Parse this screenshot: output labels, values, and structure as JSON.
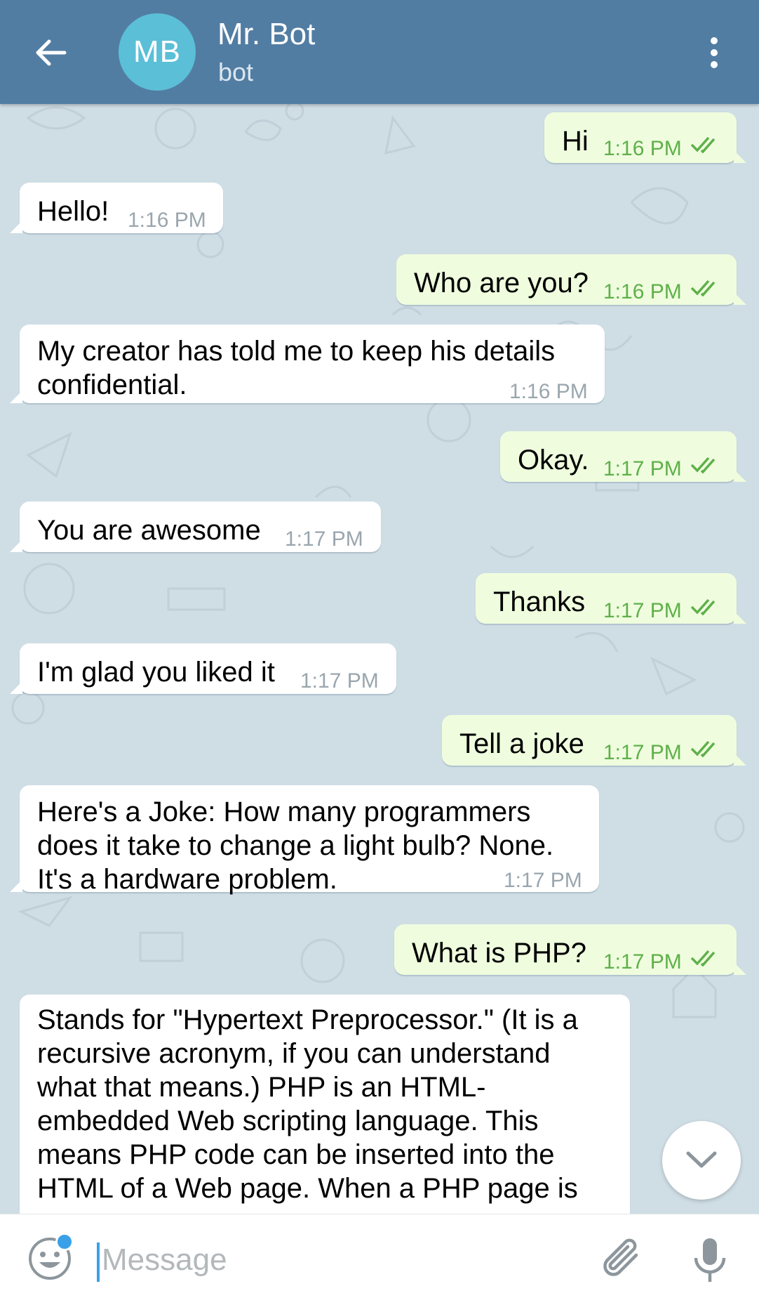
{
  "header": {
    "avatar_initials": "MB",
    "title": "Mr. Bot",
    "subtitle": "bot"
  },
  "messages": [
    {
      "dir": "out",
      "text": "Hi",
      "time": "1:16 PM",
      "status": "read"
    },
    {
      "dir": "in",
      "text": "Hello!",
      "time": "1:16 PM"
    },
    {
      "dir": "out",
      "text": "Who are you?",
      "time": "1:16 PM",
      "status": "read"
    },
    {
      "dir": "in",
      "text": "My creator has told me to keep his details confidential.",
      "time": "1:16 PM"
    },
    {
      "dir": "out",
      "text": "Okay.",
      "time": "1:17 PM",
      "status": "read"
    },
    {
      "dir": "in",
      "text": "You are awesome",
      "time": "1:17 PM"
    },
    {
      "dir": "out",
      "text": "Thanks",
      "time": "1:17 PM",
      "status": "read"
    },
    {
      "dir": "in",
      "text": "I'm glad you liked it",
      "time": "1:17 PM"
    },
    {
      "dir": "out",
      "text": "Tell a joke",
      "time": "1:17 PM",
      "status": "read"
    },
    {
      "dir": "in",
      "text": "Here's a Joke: How many programmers does it take to change a light bulb? None. It's a hardware problem.",
      "time": "1:17 PM"
    },
    {
      "dir": "out",
      "text": "What is PHP?",
      "time": "1:17 PM",
      "status": "read"
    },
    {
      "dir": "in",
      "text": "Stands for \"Hypertext Preprocessor.\" (It is a recursive acronym, if you can understand what that means.) PHP is an HTML-embedded Web scripting language. This means PHP code can be inserted into the HTML of a Web page. When a PHP page is"
    }
  ],
  "lines": {
    "m3": [
      "My creator has told me to keep his details",
      "confidential."
    ],
    "m9": [
      "Here's a Joke: How many programmers",
      "does it take to change a light bulb? None.",
      "It's a hardware problem."
    ],
    "m11": [
      "Stands for \"Hypertext Preprocessor.\"  (It is a",
      "recursive acronym, if you can understand",
      "what that means.)  PHP is an HTML-",
      "embedded Web scripting language.  This",
      "means PHP code can be inserted into the",
      "HTML of a Web page.  When a PHP page is"
    ]
  },
  "input": {
    "placeholder": "Message"
  },
  "icons": {
    "back": "arrow-left-icon",
    "menu": "more-vertical-icon",
    "emoji": "smiley-icon",
    "attach": "paperclip-icon",
    "mic": "microphone-icon",
    "scroll": "chevron-down-icon",
    "read": "double-check-icon"
  },
  "colors": {
    "header": "#527da3",
    "avatar": "#5bbfd7",
    "outgoing_bubble": "#effdde",
    "incoming_bubble": "#ffffff",
    "read_check": "#5fb04a",
    "accent": "#3aa0e8"
  }
}
